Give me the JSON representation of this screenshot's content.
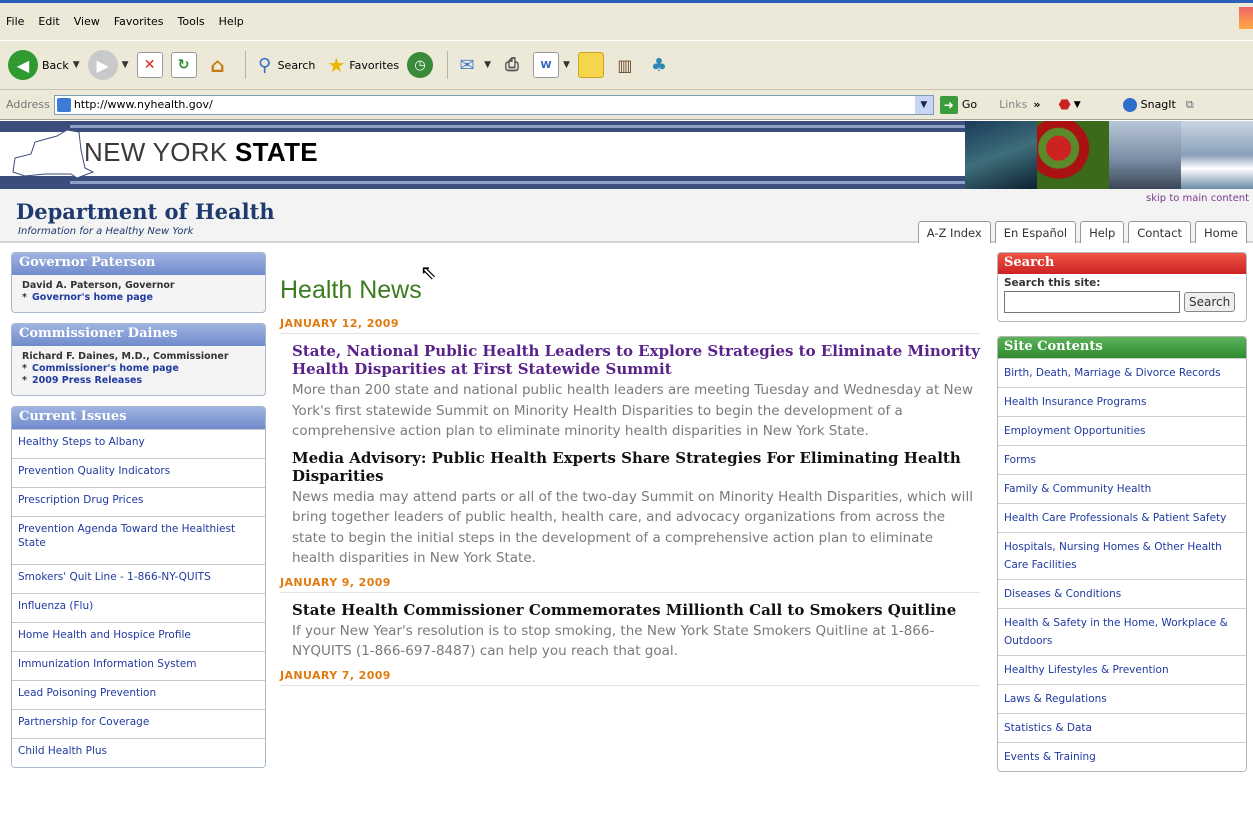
{
  "menubar": {
    "items": [
      "File",
      "Edit",
      "View",
      "Favorites",
      "Tools",
      "Help"
    ]
  },
  "toolbar": {
    "back": "Back",
    "search": "Search",
    "favorites": "Favorites",
    "icons": [
      "back-arrow-icon",
      "forward-arrow-icon",
      "stop-icon",
      "refresh-icon",
      "home-icon",
      "search-icon",
      "favorites-star-icon",
      "history-icon",
      "mail-icon",
      "print-icon",
      "edit-icon",
      "notes-icon",
      "research-icon",
      "messenger-icon"
    ]
  },
  "addressbar": {
    "label": "Address",
    "url": "http://www.nyhealth.gov/",
    "go": "Go",
    "links": "Links",
    "links_more": "»",
    "snagit": "SnagIt"
  },
  "banner": {
    "title_light": "NEW YORK ",
    "title_bold": "STATE"
  },
  "header": {
    "title": "Department of Health",
    "subtitle": "Information for a Healthy New York",
    "skip": "skip to main content",
    "tabs": [
      "A-Z Index",
      "En Español",
      "Help",
      "Contact",
      "Home"
    ]
  },
  "governor": {
    "heading": "Governor Paterson",
    "name": "David A. Paterson, Governor",
    "links": [
      "Governor's home page"
    ]
  },
  "commissioner": {
    "heading": "Commissioner Daines",
    "name": "Richard F. Daines, M.D., Commissioner",
    "links": [
      "Commissioner's home page",
      "2009 Press Releases"
    ]
  },
  "issues": {
    "heading": "Current Issues",
    "items": [
      "Healthy Steps to Albany",
      "Prevention Quality Indicators",
      "Prescription Drug Prices",
      "Prevention Agenda Toward the Healthiest State",
      "Smokers' Quit Line - 1-866-NY-QUITS",
      "Influenza (Flu)",
      "Home Health and Hospice Profile",
      "Immunization Information System",
      "Lead Poisoning Prevention",
      "Partnership for Coverage",
      "Child Health Plus"
    ]
  },
  "news": {
    "title": "Health News",
    "groups": [
      {
        "date": "JANUARY 12, 2009",
        "articles": [
          {
            "headline": "State, National Public Health Leaders to Explore Strategies to Eliminate Minority Health Disparities at First Statewide Summit",
            "text": "More than 200 state and national public health leaders are meeting Tuesday and Wednesday at New York's first statewide Summit on Minority Health Disparities to begin the development of a comprehensive action plan to eliminate minority health disparities in New York State."
          },
          {
            "headline": "Media Advisory: Public Health Experts Share Strategies For Eliminating Health Disparities",
            "text": "News media may attend parts or all of the two-day Summit on Minority Health Disparities, which will bring together leaders of public health, health care, and advocacy organizations from across the state to begin the initial steps in the development of a comprehensive action plan to eliminate health disparities in New York State."
          }
        ]
      },
      {
        "date": "JANUARY 9, 2009",
        "articles": [
          {
            "headline": "State Health Commissioner Commemorates Millionth Call to Smokers Quitline",
            "text": "If your New Year's resolution is to stop smoking, the New York State Smokers Quitline at 1-866-NYQUITS (1-866-697-8487) can help you reach that goal."
          }
        ]
      },
      {
        "date": "JANUARY 7, 2009"
      }
    ]
  },
  "search": {
    "heading": "Search",
    "label": "Search this site:",
    "value": "",
    "button": "Search"
  },
  "contents": {
    "heading": "Site Contents",
    "items": [
      "Birth, Death, Marriage & Divorce Records",
      "Health Insurance Programs",
      "Employment Opportunities",
      "Forms",
      "Family & Community Health",
      "Health Care Professionals & Patient Safety",
      "Hospitals, Nursing Homes & Other Health Care Facilities",
      "Diseases & Conditions",
      "Health & Safety in the Home, Workplace & Outdoors",
      "Healthy Lifestyles & Prevention",
      "Laws & Regulations",
      "Statistics & Data",
      "Events & Training"
    ]
  }
}
